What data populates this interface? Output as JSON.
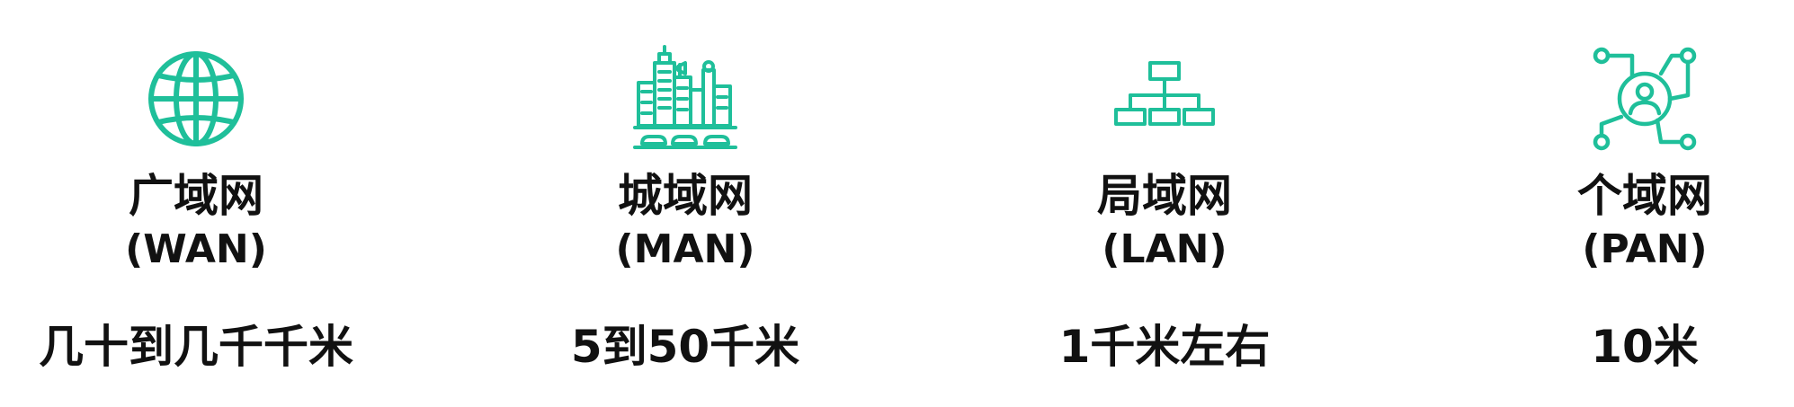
{
  "accent_color": "#1fbf9a",
  "networks": [
    {
      "icon": "globe-icon",
      "name": "广域网",
      "abbr": "(WAN)",
      "range": "几十到几千千米"
    },
    {
      "icon": "city-buildings-icon",
      "name": "城域网",
      "abbr": "(MAN)",
      "range": "5到50千米"
    },
    {
      "icon": "hierarchy-network-icon",
      "name": "局域网",
      "abbr": "(LAN)",
      "range": "1千米左右"
    },
    {
      "icon": "personal-network-icon",
      "name": "个域网",
      "abbr": "(PAN)",
      "range": "10米"
    }
  ]
}
